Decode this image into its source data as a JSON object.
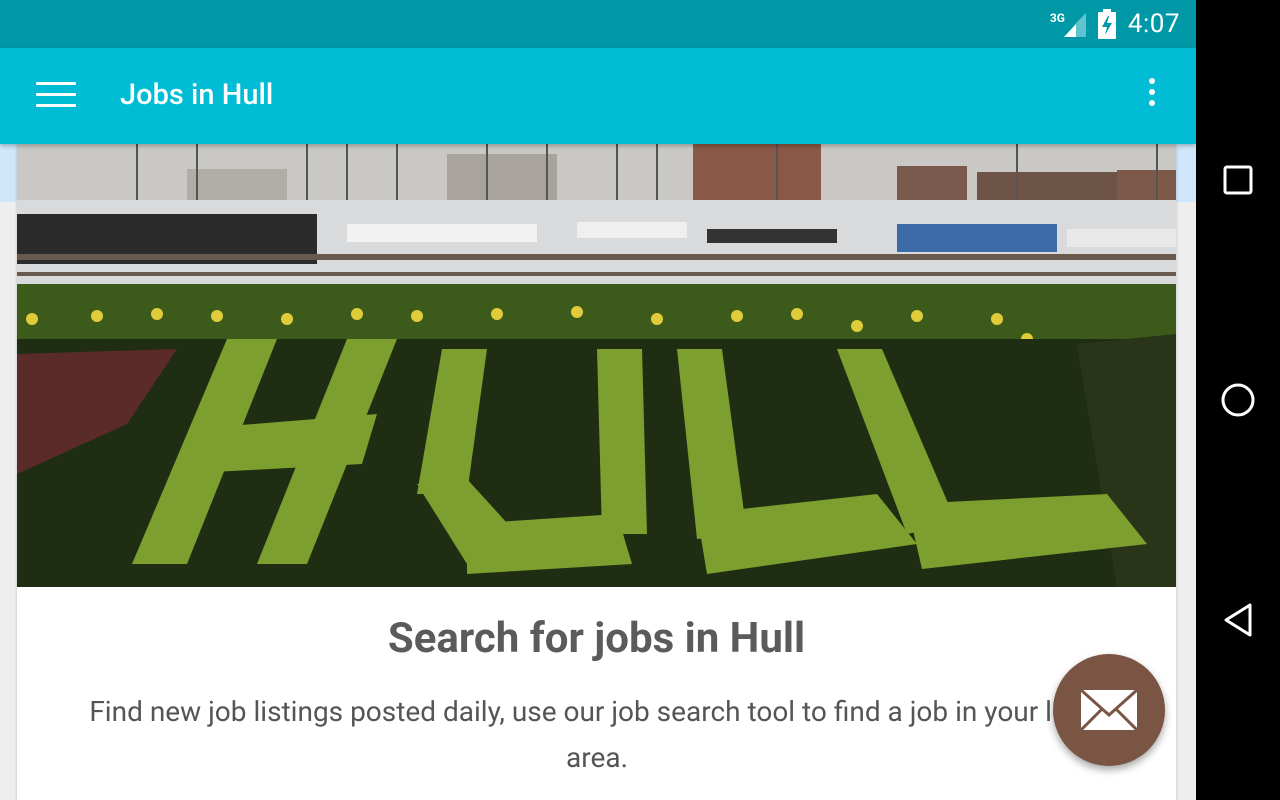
{
  "status_bar": {
    "network": "3G",
    "time": "4:07",
    "icons": [
      "signal-icon",
      "battery-charging-icon"
    ]
  },
  "app_bar": {
    "title": "Jobs in Hull",
    "menu_icon": "hamburger-menu-icon",
    "overflow_icon": "more-vert-icon"
  },
  "hero": {
    "image": "hull-marina-flowerbed-photo",
    "flower_text": "HULL"
  },
  "card": {
    "title": "Search for jobs in Hull",
    "description": "Find new job listings posted daily, use our job search tool to find a job in your local area."
  },
  "fab": {
    "icon": "envelope-icon"
  },
  "nav_bar": {
    "buttons": [
      "recents-icon",
      "home-icon",
      "back-icon"
    ]
  },
  "colors": {
    "status_bar": "#0097a7",
    "app_bar": "#00bcd4",
    "fab": "#7b5544",
    "text": "#5b5b5b"
  }
}
